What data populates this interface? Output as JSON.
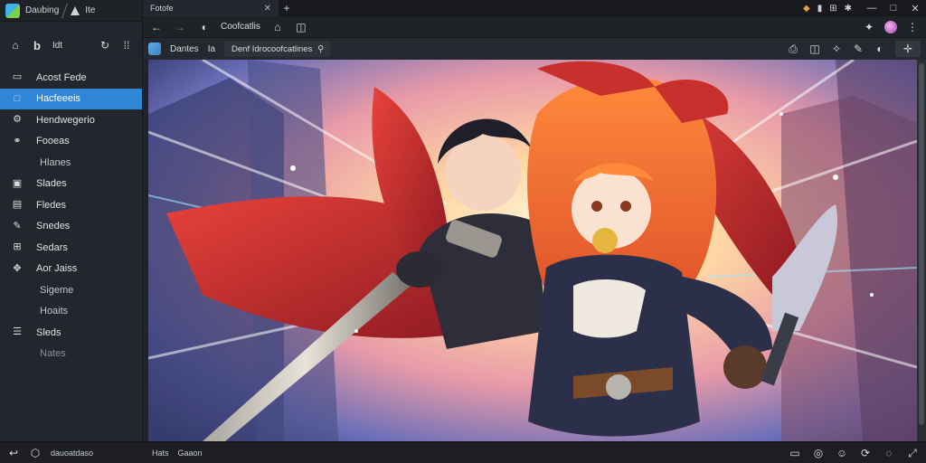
{
  "app": {
    "title": "Daubing",
    "tool_label": "Ite"
  },
  "sidebar": {
    "tool_label": "Idt",
    "items": [
      {
        "label": "Acost Fede",
        "icon": "square-outline-icon"
      },
      {
        "label": "Hacfeeeis",
        "icon": "square-icon"
      },
      {
        "label": "Hendwegerio",
        "icon": "gear-icon"
      },
      {
        "label": "Fooeas",
        "icon": "link-icon"
      },
      {
        "label": "Hlanes",
        "icon": ""
      },
      {
        "label": "Slades",
        "icon": "image-icon"
      },
      {
        "label": "Fledes",
        "icon": "document-icon"
      },
      {
        "label": "Snedes",
        "icon": "puzzle-icon"
      },
      {
        "label": "Sedars",
        "icon": "grid-icon"
      },
      {
        "label": "Aor Jaiss",
        "icon": "move-icon"
      },
      {
        "label": "Sigeme",
        "icon": ""
      },
      {
        "label": "Hoaits",
        "icon": ""
      },
      {
        "label": "Sleds",
        "icon": "list-icon"
      },
      {
        "label": "Nates",
        "icon": ""
      }
    ]
  },
  "tabs": [
    {
      "label": "Fotofe"
    }
  ],
  "toolbar": {
    "page_label": "Coofcatlis",
    "site_label": "Dantes",
    "site_suffix": "Ia",
    "address": "Denf Idrocoofcatlines"
  },
  "status": {
    "left_label": "dauoatdaso",
    "left_a": "Hats",
    "left_b": "Gaaon"
  },
  "colors": {
    "accent": "#2f86d6",
    "sidebar_bg": "#23262c",
    "main_bg": "#202328"
  }
}
